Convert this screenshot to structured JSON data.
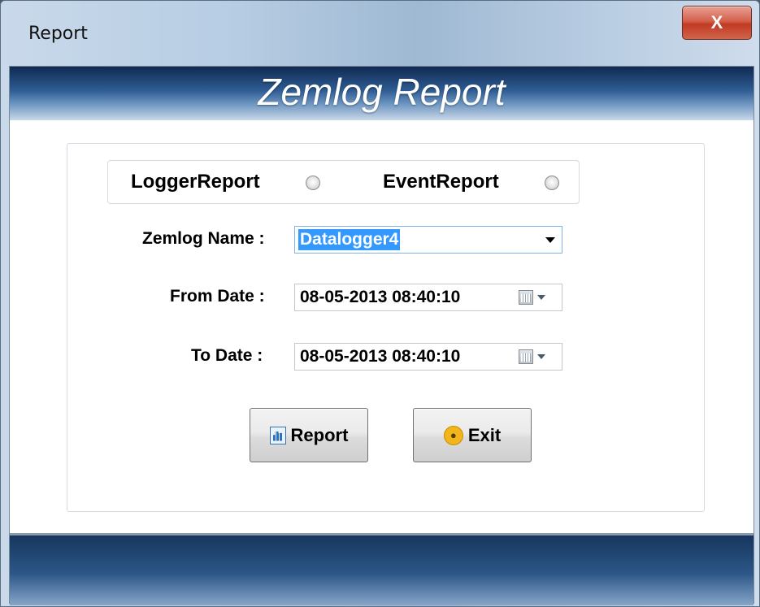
{
  "window": {
    "title": "Report",
    "close_label": "X"
  },
  "header": {
    "app_title": "Zemlog Report"
  },
  "report_type": {
    "options": [
      {
        "label": "LoggerReport",
        "selected": false
      },
      {
        "label": "EventReport",
        "selected": false
      }
    ]
  },
  "form": {
    "zemlog_name_label": "Zemlog Name :",
    "zemlog_name_value": "Datalogger4",
    "from_date_label": "From Date :",
    "from_date_value": "08-05-2013 08:40:10",
    "to_date_label": "To Date :",
    "to_date_value": "08-05-2013 08:40:10"
  },
  "actions": {
    "report_label": "Report",
    "exit_label": "Exit"
  },
  "colors": {
    "header_band": "#1f467a",
    "selection": "#3399ff",
    "close_button": "#c23a22"
  },
  "icons": [
    "close-icon",
    "radio-icon",
    "dropdown-arrow-icon",
    "calendar-icon",
    "report-chart-icon",
    "lock-icon"
  ]
}
